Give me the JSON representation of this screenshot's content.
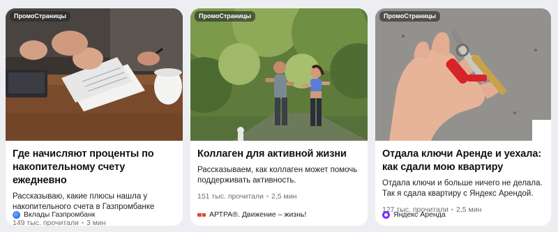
{
  "cards": [
    {
      "badge": "ПромоСтраницы",
      "title": "Где начисляют проценты по накопительному счету ежедневно",
      "description": "Рассказываю, какие плюсы нашла у накопительного счета в Газпромбанке",
      "views": "149 тыс. прочитали",
      "read_time": "3 мин",
      "source": "Вклады Газпромбанк",
      "source_logo": "gazprombank-logo-icon"
    },
    {
      "badge": "ПромоСтраницы",
      "title": "Коллаген для активной жизни",
      "description": "Рассказываем, как коллаген может помочь поддерживать активность.",
      "views": "151 тыс. прочитали",
      "read_time": "2,5 мин",
      "source": "АРТРА®. Движение – жизнь!",
      "source_logo": "artra-logo-icon"
    },
    {
      "badge": "ПромоСтраницы",
      "title": "Отдала ключи Аренде и уехала: как сдали мою квартиру",
      "description": "Отдала ключи и больше ничего не делала. Так я сдала квартиру с Яндекс Арендой.",
      "views": "127 тыс. прочитали",
      "read_time": "2,5 мин",
      "source": "Яндекс Аренда",
      "source_logo": "yandex-arenda-logo-icon"
    }
  ],
  "separator": "•"
}
